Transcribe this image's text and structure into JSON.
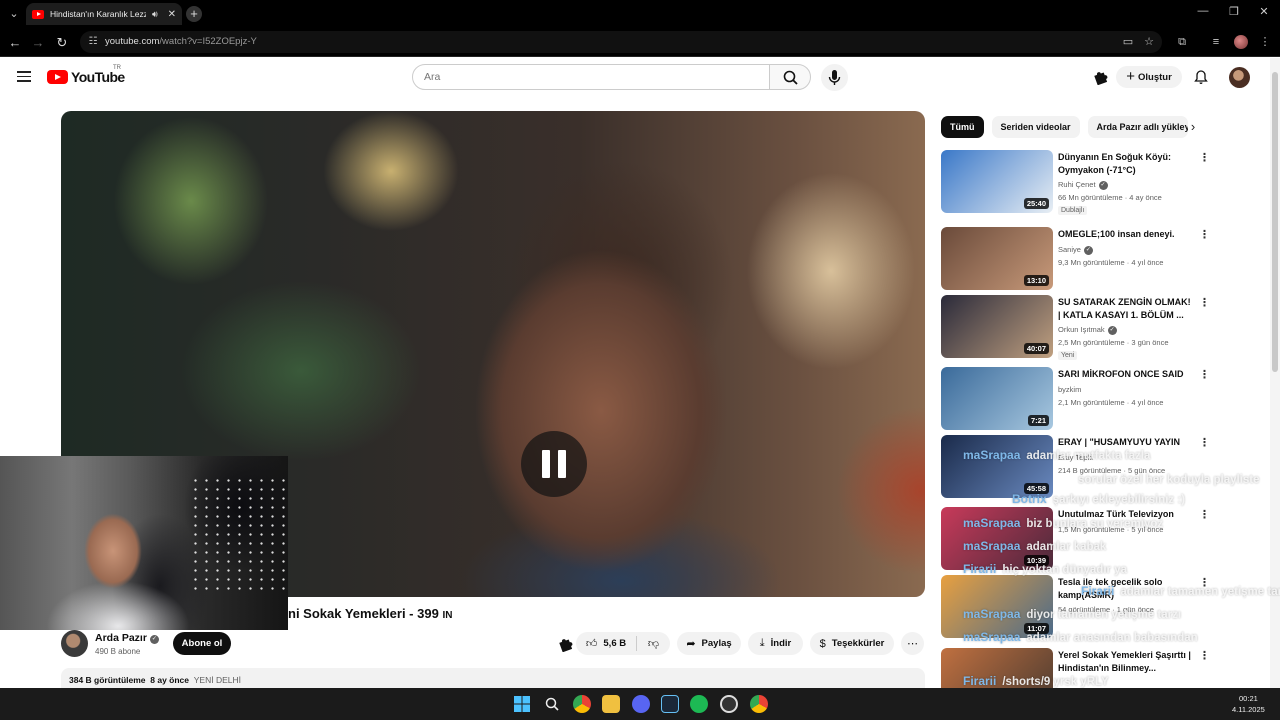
{
  "browser": {
    "tab_title": "Hindistan'ın Karanlık Lezzet",
    "url_host": "youtube.com",
    "url_path": "/watch?v=I52ZOEpjz-Y"
  },
  "header": {
    "logo_text": "YouTube",
    "country_code": "TR",
    "search_placeholder": "Ara",
    "create_label": "Oluştur"
  },
  "video": {
    "title": "ni Sokak Yemekleri - 399",
    "title_tail": "IN",
    "channel": "Arda Pazır",
    "subscribers": "490 B abone",
    "subscribe_label": "Abone ol",
    "likes": "5,6 B",
    "share_label": "Paylaş",
    "download_label": "İndir",
    "thanks_label": "Teşekkürler",
    "views": "384 B görüntüleme",
    "date": "8 ay önce",
    "location": "YENİ DELHİ"
  },
  "chips": [
    "Tümü",
    "Seriden videolar",
    "Arda Pazır adlı yükley"
  ],
  "recommendations": [
    {
      "title": "Dünyanın En Soğuk Köyü: Oymyakon (-71°C)",
      "channel": "Ruhi Çenet",
      "verified": true,
      "views": "66 Mn görüntüleme · 4 ay önce",
      "badge": "Dublajlı",
      "duration": "25:40",
      "colors": [
        "#3a78c8",
        "#e8eef4"
      ]
    },
    {
      "title": "OMEGLE;100 insan deneyi.",
      "channel": "Saniye",
      "verified": true,
      "views": "9,3 Mn görüntüleme · 4 yıl önce",
      "badge": "",
      "duration": "13:10",
      "colors": [
        "#6a4a3a",
        "#c89a7a"
      ]
    },
    {
      "title": "SU SATARAK ZENGİN OLMAK! | KATLA KASAYI 1. BÖLÜM ...",
      "channel": "Orkun Işıtmak",
      "verified": true,
      "views": "2,5 Mn görüntüleme · 3 gün önce",
      "badge": "Yeni",
      "duration": "40:07",
      "colors": [
        "#2a2a3a",
        "#c0a080"
      ]
    },
    {
      "title": "SARI MİKROFON ONCE SAID",
      "channel": "byzkim",
      "verified": false,
      "views": "2,1 Mn görüntüleme · 4 yıl önce",
      "badge": "",
      "duration": "7:21",
      "colors": [
        "#3a6a9a",
        "#a8c8e0"
      ]
    },
    {
      "title": "ERAY | \"HUSAMYUYU YAYIN",
      "channel": "Eray Tepki",
      "verified": false,
      "views": "214 B görüntüleme · 5 gün önce",
      "badge": "",
      "duration": "45:58",
      "colors": [
        "#1a2a4a",
        "#6a8ac0"
      ]
    },
    {
      "title": "Unutulmaz Türk Televizyon",
      "channel": "",
      "verified": false,
      "views": "1,5 Mn görüntüleme · 5 yıl önce",
      "badge": "",
      "duration": "10:39",
      "colors": [
        "#c83a5a",
        "#4a2a3a"
      ]
    },
    {
      "title": "Tesla ile tek gecelik solo kamp(ASMR)",
      "channel": "",
      "verified": false,
      "views": "54 görüntüleme · 1 gün önce",
      "badge": "",
      "duration": "11:07",
      "colors": [
        "#e8a040",
        "#4a6a8a"
      ]
    },
    {
      "title": "Yerel Sokak Yemekleri Şaşırttı | Hindistan'ın Bilinmey...",
      "channel": "",
      "verified": false,
      "views": "",
      "badge": "",
      "duration": "",
      "colors": [
        "#c07040",
        "#4a3a30"
      ]
    }
  ],
  "chat": [
    {
      "user": "maSrapaa",
      "message": "adamlar mutfakta fazla"
    },
    {
      "user": "",
      "message": "sorular özel her koduyla playliste"
    },
    {
      "user": "Botrix",
      "message": "şarkıyı ekleyebilirsiniz :)"
    },
    {
      "user": "maSrapaa",
      "message": "biz bunlara su veremiyoz"
    },
    {
      "user": "maSrapaa",
      "message": "adamlar kabak"
    },
    {
      "user": "Firarii",
      "message": "hiç yoktan dünyadır ya"
    },
    {
      "user": "Firarii",
      "message": "adamlar tamamen yetişme tarzı"
    },
    {
      "user": "maSrapaa",
      "message": "diyor tamamen yetişme tarzı"
    },
    {
      "user": "maSrapaa",
      "message": "adamlar anasından babasından"
    },
    {
      "user": "Firarii",
      "message": "/shorts/9 yrsk yRLY"
    },
    {
      "user": "maSrapaa",
      "message": "ayak çigköftesi olsa yersiniz"
    }
  ],
  "taskbar": {
    "time": "00:21",
    "date": "4.11.2025"
  }
}
